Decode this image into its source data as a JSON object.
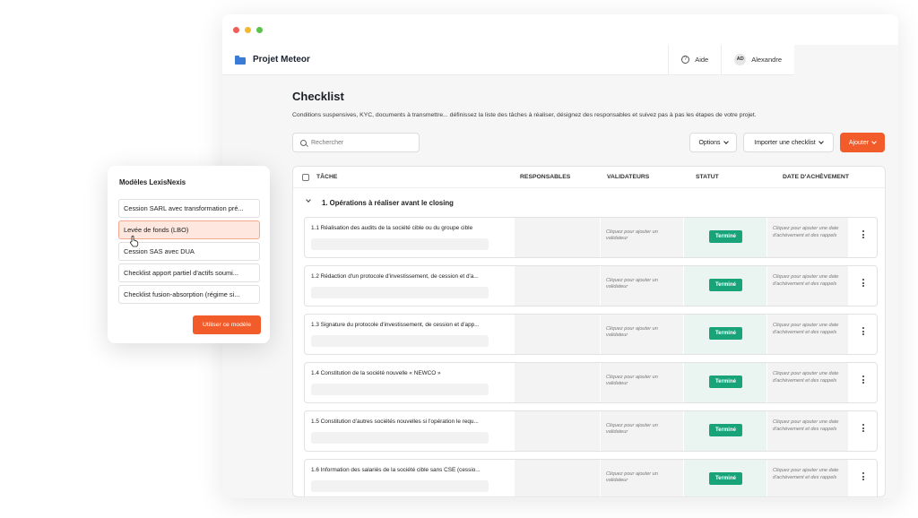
{
  "header": {
    "project_name": "Projet Meteor",
    "help_label": "Aide",
    "user_initials": "AD",
    "user_name": "Alexandre"
  },
  "page": {
    "title": "Checklist",
    "description": "Conditions suspensives, KYC, documents à transmettre... définissez la liste des tâches à réaliser, désignez des responsables et suivez pas à pas les étapes de votre projet."
  },
  "toolbar": {
    "search_placeholder": "Rechercher",
    "options_label": "Options",
    "import_label": "Importer une checklist",
    "add_label": "Ajouter"
  },
  "table": {
    "columns": {
      "task": "TÂCHE",
      "responsables": "RESPONSABLES",
      "validateurs": "VALIDATEURS",
      "statut": "STATUT",
      "date": "DATE D'ACHÈVEMENT"
    },
    "section_title": "1. Opérations à réaliser avant le closing",
    "validator_hint": "Cliquez pour ajouter un validateur",
    "date_hint": "Cliquez pour ajouter une date d'achèvement et des rappels",
    "rows": [
      {
        "task": "1.1 Réalisation des audits de la société cible ou du groupe cible",
        "status": "Terminé"
      },
      {
        "task": "1.2 Rédaction d'un protocole d'investissement, de cession et d'a...",
        "status": "Terminé"
      },
      {
        "task": "1.3 Signature du protocole d'investissement, de cession et d'app...",
        "status": "Terminé"
      },
      {
        "task": "1.4 Constitution de la société nouvelle « NEWCO »",
        "status": "Terminé"
      },
      {
        "task": "1.5 Constitution d'autres sociétés nouvelles si l'opération le requ...",
        "status": "Terminé"
      },
      {
        "task": "1.6 Information des salariés de la société cible sans CSE (cessio...",
        "status": "Terminé"
      }
    ]
  },
  "modal": {
    "title": "Modèles LexisNexis",
    "templates": [
      "Cession SARL avec transformation pré...",
      "Levée de fonds (LBO)",
      "Cession SAS avec DUA",
      "Checklist apport partiel d'actifs soumi...",
      "Checklist fusion-absorption (régime si..."
    ],
    "selected_index": 1,
    "use_button": "Utiliser ce modèle"
  },
  "colors": {
    "accent": "#f25b2a",
    "success": "#18a379",
    "selected_bg": "#fde7df",
    "link_blue": "#3b7bd8"
  }
}
